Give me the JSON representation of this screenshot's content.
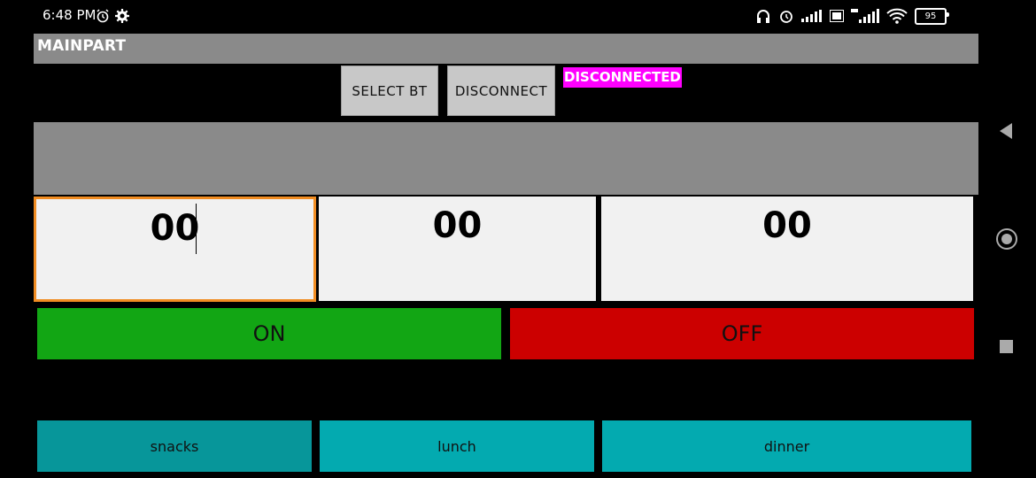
{
  "status_bar": {
    "time": "6:48 PM",
    "battery": "95"
  },
  "app": {
    "title": "MAINPART",
    "select_bt_label": "SELECT BT",
    "disconnect_label": "DISCONNECT",
    "connection_status": "DISCONNECTED",
    "status_color": "#ff00ff"
  },
  "time_fields": [
    {
      "value": "00"
    },
    {
      "value": "00"
    },
    {
      "value": "00"
    }
  ],
  "controls": {
    "on_label": "ON",
    "off_label": "OFF",
    "on_color": "#12a614",
    "off_color": "#cc0000"
  },
  "meals": [
    {
      "label": "snacks"
    },
    {
      "label": "lunch"
    },
    {
      "label": "dinner"
    }
  ],
  "nav": {
    "icons": [
      "back-icon",
      "home-icon",
      "recents-icon"
    ]
  }
}
